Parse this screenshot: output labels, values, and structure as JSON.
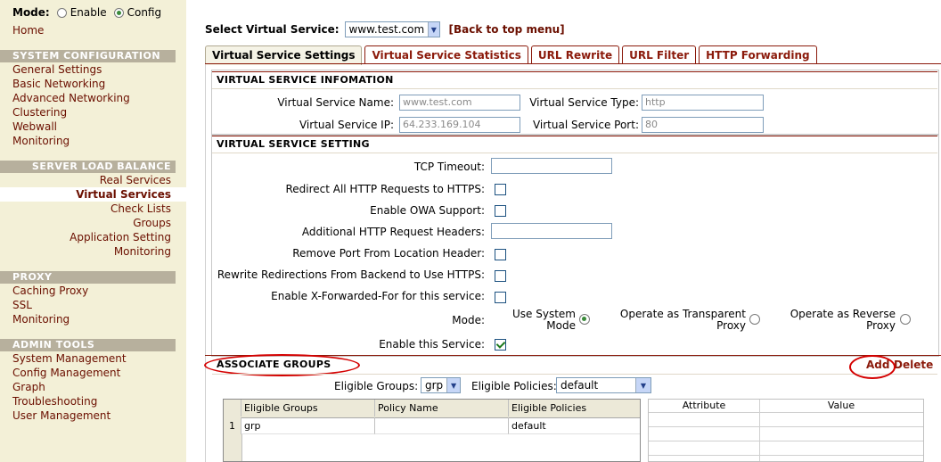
{
  "sidebar": {
    "mode_label": "Mode:",
    "mode_options": [
      {
        "label": "Enable",
        "selected": false
      },
      {
        "label": "Config",
        "selected": true
      }
    ],
    "home": "Home",
    "system_configuration": {
      "title": "SYSTEM CONFIGURATION",
      "items": [
        "General Settings",
        "Basic Networking",
        "Advanced Networking",
        "Clustering",
        "Webwall",
        "Monitoring"
      ]
    },
    "server_load_balance": {
      "title": "SERVER LOAD BALANCE",
      "items": [
        "Real Services",
        "Virtual Services",
        "Check Lists",
        "Groups",
        "Application Setting",
        "Monitoring"
      ],
      "active": "Virtual Services"
    },
    "proxy": {
      "title": "PROXY",
      "items": [
        "Caching Proxy",
        "SSL",
        "Monitoring"
      ]
    },
    "admin_tools": {
      "title": "ADMIN TOOLS",
      "items": [
        "System Management",
        "Config Management",
        "Graph",
        "Troubleshooting",
        "User Management"
      ]
    }
  },
  "topbar": {
    "select_label": "Select Virtual Service:",
    "selected_service": "www.test.com",
    "back_link": "[Back to top menu]"
  },
  "tabs": [
    {
      "label": "Virtual Service Settings",
      "active": true
    },
    {
      "label": "Virtual Service Statistics",
      "active": false
    },
    {
      "label": "URL Rewrite",
      "active": false
    },
    {
      "label": "URL Filter",
      "active": false
    },
    {
      "label": "HTTP Forwarding",
      "active": false
    }
  ],
  "info": {
    "title": "VIRTUAL SERVICE INFOMATION",
    "name_label": "Virtual Service Name:",
    "name_value": "www.test.com",
    "type_label": "Virtual Service Type:",
    "type_value": "http",
    "ip_label": "Virtual Service IP:",
    "ip_value": "64.233.169.104",
    "port_label": "Virtual Service Port:",
    "port_value": "80"
  },
  "setting": {
    "title": "VIRTUAL SERVICE SETTING",
    "tcp_timeout_label": "TCP Timeout:",
    "tcp_timeout_value": "",
    "redirect_https_label": "Redirect All HTTP Requests to HTTPS:",
    "redirect_https_checked": false,
    "owa_label": "Enable OWA Support:",
    "owa_checked": false,
    "headers_label": "Additional HTTP Request Headers:",
    "headers_value": "",
    "remove_port_label": "Remove Port From Location Header:",
    "remove_port_checked": false,
    "rewrite_label": "Rewrite Redirections From Backend to Use HTTPS:",
    "rewrite_checked": false,
    "xff_label": "Enable X-Forwarded-For for this service:",
    "xff_checked": false,
    "mode_label": "Mode:",
    "mode_options": [
      {
        "line1": "Use System",
        "line2": "Mode",
        "selected": true
      },
      {
        "line1": "Operate as Transparent",
        "line2": "Proxy",
        "selected": false
      },
      {
        "line1": "Operate as Reverse",
        "line2": "Proxy",
        "selected": false
      }
    ],
    "enable_label": "Enable this Service:",
    "enable_checked": true
  },
  "groups": {
    "title": "ASSOCIATE GROUPS",
    "add": "Add",
    "delete": "Delete",
    "eligible_groups_label": "Eligible Groups:",
    "eligible_groups_value": "grp",
    "eligible_policies_label": "Eligible Policies:",
    "eligible_policies_value": "default",
    "table_headers": [
      "Eligible Groups",
      "Policy Name",
      "Eligible Policies"
    ],
    "rows": [
      {
        "num": "1",
        "group": "grp",
        "policy": "",
        "eligible": "default"
      }
    ],
    "attr_headers": [
      "Attribute",
      "Value"
    ]
  },
  "colors": {
    "sidebar_bg": "#f3f0d7",
    "section_head_bg": "#b7b09d",
    "link": "#6b0f00",
    "accent": "#8b1a0b",
    "annotation": "#d40000"
  }
}
